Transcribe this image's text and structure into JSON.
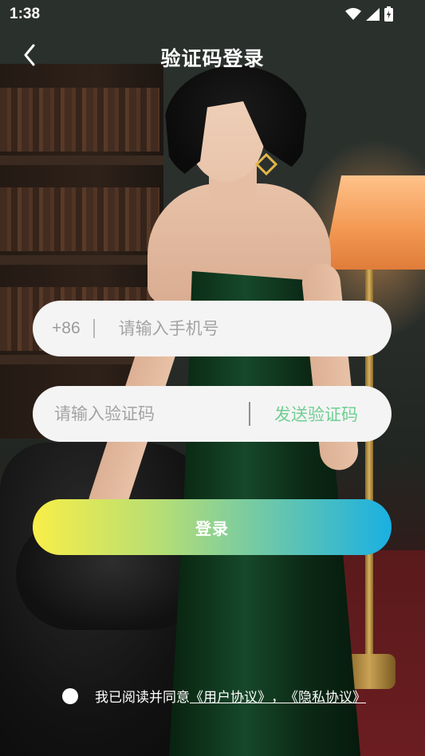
{
  "status_bar": {
    "time": "1:38",
    "icons": [
      "wifi-icon",
      "signal-icon",
      "battery-charging-icon"
    ]
  },
  "header": {
    "title": "验证码登录",
    "back_icon": "chevron-left-icon"
  },
  "form": {
    "phone": {
      "country_code": "+86",
      "placeholder": "请输入手机号",
      "value": ""
    },
    "code": {
      "placeholder": "请输入验证码",
      "value": "",
      "send_label": "发送验证码"
    },
    "login_label": "登录"
  },
  "agreement": {
    "checked": false,
    "prefix": "我已阅读并同意",
    "user_agreement": "《用户协议》",
    "separator": "，",
    "privacy_policy": "《隐私协议》"
  },
  "colors": {
    "send_code": "#6fcf93",
    "login_gradient_start": "#f8ee48",
    "login_gradient_end": "#1ab0e2",
    "field_background": "#f4f4f4"
  }
}
